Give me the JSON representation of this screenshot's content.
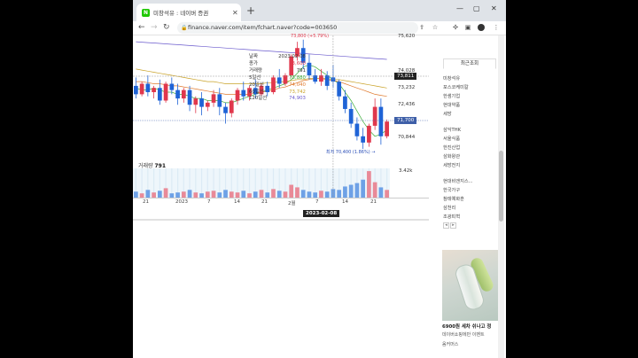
{
  "browser": {
    "tab_title": "미창석유 : 네이버 증권",
    "tab_favicon": "N",
    "tab_close": "✕",
    "new_tab": "+",
    "url": "finance.naver.com/item/fchart.naver?code=003650",
    "controls": {
      "minimize": "—",
      "maximize": "▢",
      "close": "✕"
    }
  },
  "chart": {
    "top_cutoff_label": "73,800 (+5.79%)",
    "volume_label": "거래량",
    "volume_value": "791",
    "volume_axis_top": "3.42k",
    "selected_date": "2023-02-08",
    "low_label": "최저 70,400 (1.86%) →",
    "tooltip": [
      {
        "k": "날짜",
        "v": "2023.02.08",
        "color": "#333333"
      },
      {
        "k": "종가",
        "v": "73,600",
        "color": "#e0374c"
      },
      {
        "k": "거래량",
        "v": "791",
        "color": "#333333"
      },
      {
        "k": "5일선",
        "v": "73,880",
        "color": "#3fae3a"
      },
      {
        "k": "20일선",
        "v": "74,040",
        "color": "#e07a2e"
      },
      {
        "k": "60일선",
        "v": "73,742",
        "color": "#c9a227"
      },
      {
        "k": "120일선",
        "v": "74,903",
        "color": "#6a5acd"
      }
    ],
    "y_labels": [
      "75,620",
      "74,028",
      "73,232",
      "72,436",
      "70,844"
    ],
    "y_badge_current": "73,811",
    "y_badge_price": "71,700",
    "x_labels": [
      "21",
      "2023",
      "7",
      "14",
      "21",
      "2월",
      "7",
      "14",
      "21"
    ]
  },
  "sidebar": {
    "tab_label": "최근조회",
    "recent_groups": [
      [
        "미창석유",
        "포스코케미칼",
        "한샘기업",
        "현대약품",
        "세방"
      ],
      [
        "삼익THK",
        "서울식품",
        "한진산업",
        "삼화왕관",
        "세방전지"
      ],
      [
        "현대비앤지스...",
        "한국가구",
        "참테예화훈",
        "삼천리",
        "조광피혁"
      ]
    ],
    "pager": [
      "◂",
      "▸"
    ],
    "ad_title": "6900원 세차 쉬나고 정",
    "ad_sub": "데이버쇼핑에만 이벤트",
    "ad_brand": "옴커머스"
  },
  "chart_data": {
    "type": "candlestick",
    "x_date_ticks": [
      "21",
      "2023",
      "7",
      "14",
      "21",
      "2월",
      "7",
      "14",
      "21"
    ],
    "ylim": [
      70400,
      75800
    ],
    "candles": [
      {
        "o": 73400,
        "h": 73800,
        "c": 73000,
        "l": 72800
      },
      {
        "o": 73000,
        "h": 73600,
        "c": 73500,
        "l": 72900
      },
      {
        "o": 73500,
        "h": 73900,
        "c": 73100,
        "l": 72900
      },
      {
        "o": 73100,
        "h": 73400,
        "c": 73300,
        "l": 72800
      },
      {
        "o": 73300,
        "h": 73700,
        "c": 72700,
        "l": 72500
      },
      {
        "o": 72700,
        "h": 73600,
        "c": 73500,
        "l": 72600
      },
      {
        "o": 73500,
        "h": 73800,
        "c": 73200,
        "l": 73000
      },
      {
        "o": 73200,
        "h": 73500,
        "c": 72800,
        "l": 72500
      },
      {
        "o": 72800,
        "h": 73300,
        "c": 73200,
        "l": 72600
      },
      {
        "o": 73200,
        "h": 73400,
        "c": 72500,
        "l": 72200
      },
      {
        "o": 72500,
        "h": 72900,
        "c": 72800,
        "l": 72100
      },
      {
        "o": 72800,
        "h": 73100,
        "c": 72400,
        "l": 72000
      },
      {
        "o": 72400,
        "h": 72700,
        "c": 72600,
        "l": 72200
      },
      {
        "o": 72600,
        "h": 73200,
        "c": 73000,
        "l": 72400
      },
      {
        "o": 73000,
        "h": 73300,
        "c": 72400,
        "l": 72000
      },
      {
        "o": 72400,
        "h": 72600,
        "c": 72100,
        "l": 71600
      },
      {
        "o": 72100,
        "h": 72800,
        "c": 72700,
        "l": 71900
      },
      {
        "o": 72700,
        "h": 73300,
        "c": 73200,
        "l": 72500
      },
      {
        "o": 73200,
        "h": 73600,
        "c": 72900,
        "l": 72700
      },
      {
        "o": 72900,
        "h": 73400,
        "c": 73300,
        "l": 72700
      },
      {
        "o": 73300,
        "h": 73700,
        "c": 73000,
        "l": 72800
      },
      {
        "o": 73000,
        "h": 73500,
        "c": 73400,
        "l": 72900
      },
      {
        "o": 73400,
        "h": 73600,
        "c": 73100,
        "l": 72900
      },
      {
        "o": 73100,
        "h": 73900,
        "c": 73800,
        "l": 73000
      },
      {
        "o": 73800,
        "h": 74200,
        "c": 73500,
        "l": 73300
      },
      {
        "o": 73500,
        "h": 74000,
        "c": 73900,
        "l": 73400
      },
      {
        "o": 73900,
        "h": 74900,
        "c": 74800,
        "l": 73800
      },
      {
        "o": 74800,
        "h": 75500,
        "c": 75200,
        "l": 74600
      },
      {
        "o": 75200,
        "h": 75600,
        "c": 74500,
        "l": 74200
      },
      {
        "o": 74500,
        "h": 74900,
        "c": 73900,
        "l": 73700
      },
      {
        "o": 73900,
        "h": 74200,
        "c": 73600,
        "l": 73500
      },
      {
        "o": 73600,
        "h": 74200,
        "c": 73900,
        "l": 73400
      },
      {
        "o": 73900,
        "h": 74100,
        "c": 73400,
        "l": 73200
      },
      {
        "o": 73800,
        "h": 74400,
        "c": 73600,
        "l": 73300
      },
      {
        "o": 73600,
        "h": 73700,
        "c": 72900,
        "l": 72700
      },
      {
        "o": 72900,
        "h": 73200,
        "c": 72300,
        "l": 72100
      },
      {
        "o": 72300,
        "h": 72600,
        "c": 71600,
        "l": 71400
      },
      {
        "o": 71600,
        "h": 71900,
        "c": 71000,
        "l": 70800
      },
      {
        "o": 71000,
        "h": 71400,
        "c": 70700,
        "l": 70400
      },
      {
        "o": 70700,
        "h": 71600,
        "c": 71500,
        "l": 70500
      },
      {
        "o": 71500,
        "h": 72800,
        "c": 72400,
        "l": 71300
      },
      {
        "o": 72400,
        "h": 72800,
        "c": 71000,
        "l": 70600
      },
      {
        "o": 71000,
        "h": 71800,
        "c": 71700,
        "l": 70900
      }
    ],
    "volume_ylim": [
      0,
      3420
    ],
    "volumes": [
      700,
      500,
      900,
      600,
      800,
      1100,
      500,
      600,
      700,
      900,
      600,
      500,
      700,
      800,
      600,
      900,
      700,
      600,
      800,
      500,
      700,
      900,
      600,
      1000,
      800,
      700,
      1500,
      1200,
      900,
      700,
      600,
      800,
      700,
      1000,
      900,
      1300,
      1500,
      1700,
      2100,
      3100,
      1800,
      1200,
      900
    ],
    "moving_averages": [
      {
        "name": "5일선",
        "color": "#3fae3a",
        "values": [
          73300,
          73200,
          73200,
          73300,
          73200,
          73100,
          73100,
          73000,
          73000,
          72900,
          72800,
          72800,
          72700,
          72700,
          72700,
          72600,
          72600,
          72700,
          72800,
          72900,
          73000,
          73100,
          73200,
          73300,
          73400,
          73500,
          73700,
          74000,
          74300,
          74400,
          74300,
          74100,
          73900,
          73700,
          73500,
          73100,
          72700,
          72200,
          71700,
          71300,
          71000,
          71100,
          71300
        ]
      },
      {
        "name": "20일선",
        "color": "#e07a2e",
        "values": [
          73600,
          73600,
          73550,
          73500,
          73500,
          73450,
          73400,
          73400,
          73350,
          73300,
          73250,
          73200,
          73150,
          73100,
          73050,
          73000,
          73000,
          73000,
          73000,
          73000,
          73050,
          73100,
          73150,
          73200,
          73300,
          73350,
          73450,
          73550,
          73650,
          73700,
          73750,
          73750,
          73700,
          73650,
          73600,
          73500,
          73400,
          73300,
          73200,
          73100,
          73000,
          72950,
          72900
        ]
      },
      {
        "name": "60일선",
        "color": "#c9a227",
        "values": [
          74200,
          74150,
          74100,
          74050,
          74000,
          73950,
          73900,
          73850,
          73800,
          73750,
          73700,
          73650,
          73600,
          73600,
          73550,
          73500,
          73500,
          73500,
          73500,
          73500,
          73500,
          73500,
          73550,
          73550,
          73600,
          73600,
          73650,
          73700,
          73700,
          73750,
          73750,
          73750,
          73750,
          73700,
          73700,
          73650,
          73600,
          73550,
          73500,
          73450,
          73400,
          73350,
          73300
        ]
      },
      {
        "name": "120일선",
        "color": "#6a5acd",
        "values": [
          75500,
          75480,
          75460,
          75440,
          75420,
          75400,
          75380,
          75360,
          75340,
          75320,
          75300,
          75280,
          75260,
          75240,
          75220,
          75200,
          75180,
          75160,
          75140,
          75120,
          75100,
          75080,
          75060,
          75040,
          75020,
          75000,
          74980,
          74960,
          74940,
          74920,
          74900,
          74880,
          74860,
          74840,
          74820,
          74800,
          74780,
          74760,
          74740,
          74720,
          74700,
          74680,
          74660
        ]
      }
    ]
  }
}
